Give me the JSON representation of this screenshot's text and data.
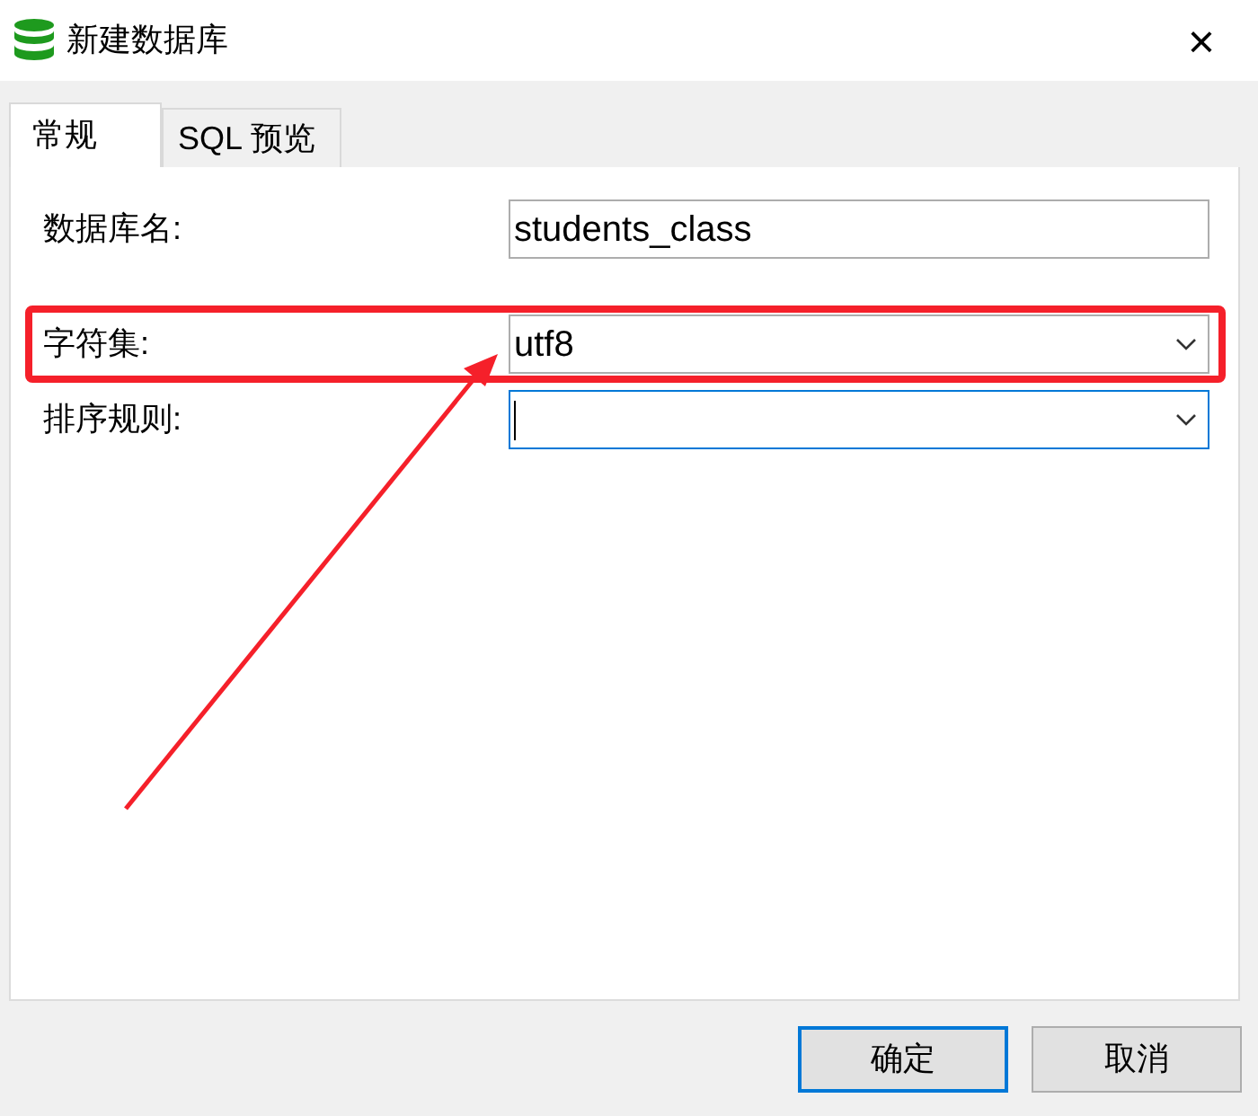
{
  "window": {
    "title": "新建数据库",
    "close": "×"
  },
  "tabs": [
    {
      "label": "常规",
      "selected": true
    },
    {
      "label": "SQL 预览",
      "selected": false
    }
  ],
  "fields": [
    {
      "kind": "text",
      "label": "数据库名:",
      "value": "students_class",
      "highlighted": false,
      "focused": false
    },
    {
      "kind": "combo",
      "label": "字符集:",
      "value": "utf8",
      "highlighted": true,
      "focused": false
    },
    {
      "kind": "combo",
      "label": "排序规则:",
      "highlighted": false,
      "focused": true
    }
  ],
  "buttons": [
    {
      "label": "确定",
      "default": true
    },
    {
      "label": "取消",
      "default": false
    }
  ]
}
